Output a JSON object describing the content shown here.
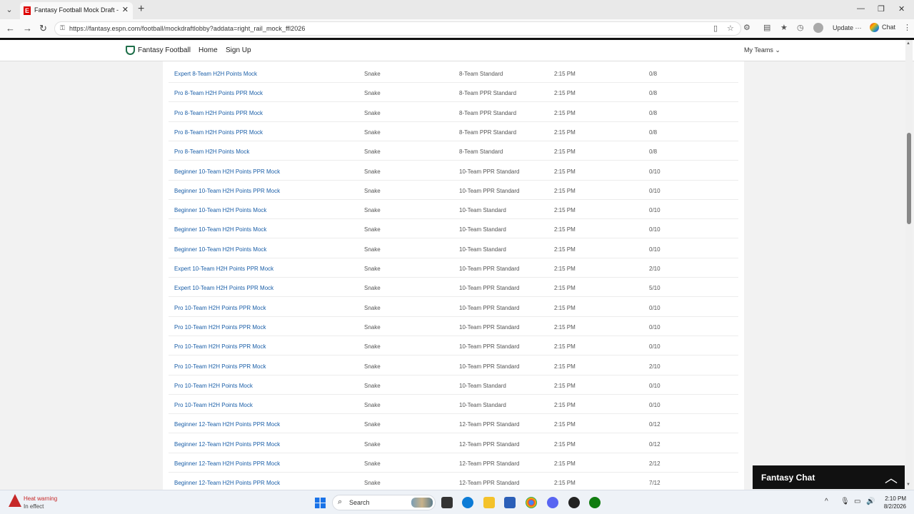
{
  "browser": {
    "tab_title": "Fantasy Football Mock Draft - ESPN",
    "tab_menu_icon": "chevron-down",
    "url": "https://fantasy.espn.com/football/mockdraftlobby?addata=right_rail_mock_ffl2026",
    "update_label": "Update",
    "chat_label": "Chat"
  },
  "header": {
    "brand": "Fantasy Football",
    "links": [
      "Home",
      "Sign Up"
    ],
    "my_teams": "My Teams"
  },
  "drafts": [
    {
      "name": "Expert 8-Team H2H Points Mock",
      "type": "Snake",
      "format": "8-Team Standard",
      "time": "2:15 PM",
      "count": "0/8"
    },
    {
      "name": "Pro 8-Team H2H Points PPR Mock",
      "type": "Snake",
      "format": "8-Team PPR Standard",
      "time": "2:15 PM",
      "count": "0/8"
    },
    {
      "name": "Pro 8-Team H2H Points PPR Mock",
      "type": "Snake",
      "format": "8-Team PPR Standard",
      "time": "2:15 PM",
      "count": "0/8"
    },
    {
      "name": "Pro 8-Team H2H Points PPR Mock",
      "type": "Snake",
      "format": "8-Team PPR Standard",
      "time": "2:15 PM",
      "count": "0/8"
    },
    {
      "name": "Pro 8-Team H2H Points Mock",
      "type": "Snake",
      "format": "8-Team Standard",
      "time": "2:15 PM",
      "count": "0/8"
    },
    {
      "name": "Beginner 10-Team H2H Points PPR Mock",
      "type": "Snake",
      "format": "10-Team PPR Standard",
      "time": "2:15 PM",
      "count": "0/10"
    },
    {
      "name": "Beginner 10-Team H2H Points PPR Mock",
      "type": "Snake",
      "format": "10-Team PPR Standard",
      "time": "2:15 PM",
      "count": "0/10"
    },
    {
      "name": "Beginner 10-Team H2H Points Mock",
      "type": "Snake",
      "format": "10-Team Standard",
      "time": "2:15 PM",
      "count": "0/10"
    },
    {
      "name": "Beginner 10-Team H2H Points Mock",
      "type": "Snake",
      "format": "10-Team Standard",
      "time": "2:15 PM",
      "count": "0/10"
    },
    {
      "name": "Beginner 10-Team H2H Points Mock",
      "type": "Snake",
      "format": "10-Team Standard",
      "time": "2:15 PM",
      "count": "0/10"
    },
    {
      "name": "Expert 10-Team H2H Points PPR Mock",
      "type": "Snake",
      "format": "10-Team PPR Standard",
      "time": "2:15 PM",
      "count": "2/10"
    },
    {
      "name": "Expert 10-Team H2H Points PPR Mock",
      "type": "Snake",
      "format": "10-Team PPR Standard",
      "time": "2:15 PM",
      "count": "5/10"
    },
    {
      "name": "Pro 10-Team H2H Points PPR Mock",
      "type": "Snake",
      "format": "10-Team PPR Standard",
      "time": "2:15 PM",
      "count": "0/10"
    },
    {
      "name": "Pro 10-Team H2H Points PPR Mock",
      "type": "Snake",
      "format": "10-Team PPR Standard",
      "time": "2:15 PM",
      "count": "0/10"
    },
    {
      "name": "Pro 10-Team H2H Points PPR Mock",
      "type": "Snake",
      "format": "10-Team PPR Standard",
      "time": "2:15 PM",
      "count": "0/10"
    },
    {
      "name": "Pro 10-Team H2H Points PPR Mock",
      "type": "Snake",
      "format": "10-Team PPR Standard",
      "time": "2:15 PM",
      "count": "2/10"
    },
    {
      "name": "Pro 10-Team H2H Points Mock",
      "type": "Snake",
      "format": "10-Team Standard",
      "time": "2:15 PM",
      "count": "0/10"
    },
    {
      "name": "Pro 10-Team H2H Points Mock",
      "type": "Snake",
      "format": "10-Team Standard",
      "time": "2:15 PM",
      "count": "0/10"
    },
    {
      "name": "Beginner 12-Team H2H Points PPR Mock",
      "type": "Snake",
      "format": "12-Team PPR Standard",
      "time": "2:15 PM",
      "count": "0/12"
    },
    {
      "name": "Beginner 12-Team H2H Points PPR Mock",
      "type": "Snake",
      "format": "12-Team PPR Standard",
      "time": "2:15 PM",
      "count": "0/12"
    },
    {
      "name": "Beginner 12-Team H2H Points PPR Mock",
      "type": "Snake",
      "format": "12-Team PPR Standard",
      "time": "2:15 PM",
      "count": "2/12"
    },
    {
      "name": "Beginner 12-Team H2H Points PPR Mock",
      "type": "Snake",
      "format": "12-Team PPR Standard",
      "time": "2:15 PM",
      "count": "7/12"
    }
  ],
  "fantasy_chat": {
    "title": "Fantasy Chat"
  },
  "taskbar": {
    "weather_title": "Heat warning",
    "weather_sub": "In effect",
    "search_placeholder": "Search",
    "time": "2:10 PM",
    "date": "8/2/2026"
  },
  "colors": {
    "link": "#1b5fa8",
    "espn_red": "#d00000",
    "chat_bg": "#111111"
  }
}
